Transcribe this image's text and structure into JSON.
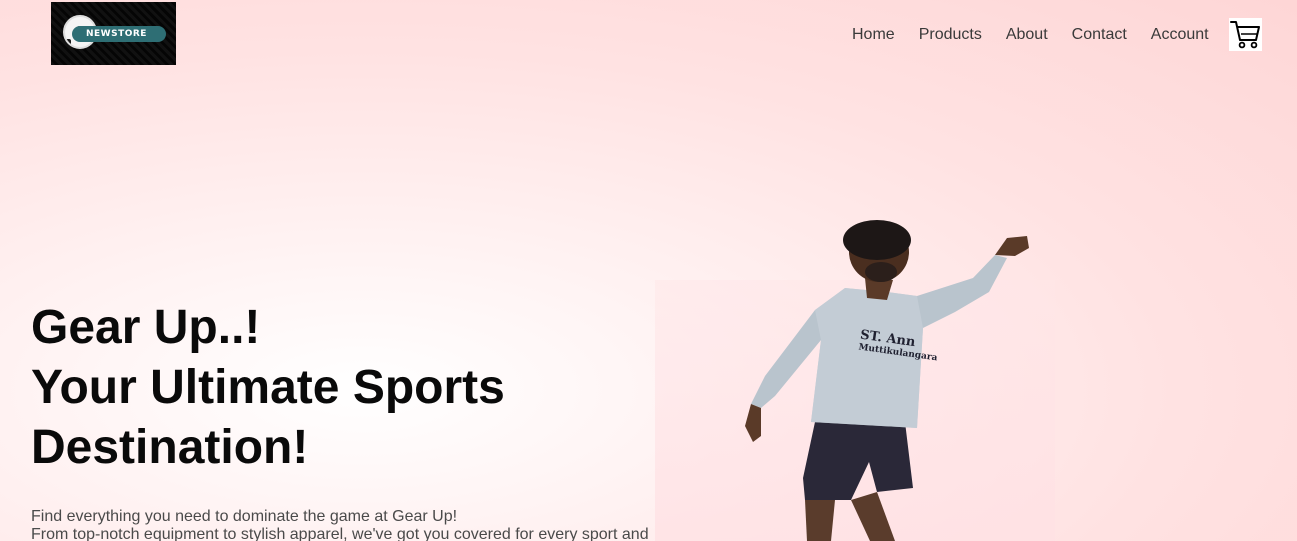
{
  "header": {
    "logo_text": "NEWSTORE",
    "nav": [
      "Home",
      "Products",
      "About",
      "Contact",
      "Account"
    ]
  },
  "hero": {
    "title_lines": [
      "Gear Up..!",
      "Your Ultimate Sports",
      "Destination!"
    ],
    "description_lines": [
      "Find everything you need to dominate the game at Gear Up!",
      "From top-notch equipment to stylish apparel, we've got you covered for every sport and"
    ],
    "image_jersey_text": [
      "ST. Ann",
      "Muttikulangara"
    ]
  },
  "icons": {
    "cart": "cart-icon",
    "logo_ball": "soccer-ball-icon"
  },
  "colors": {
    "nav_text": "#3a3a3a",
    "logo_banner": "#2e6e74",
    "background": "#fed6d6"
  }
}
